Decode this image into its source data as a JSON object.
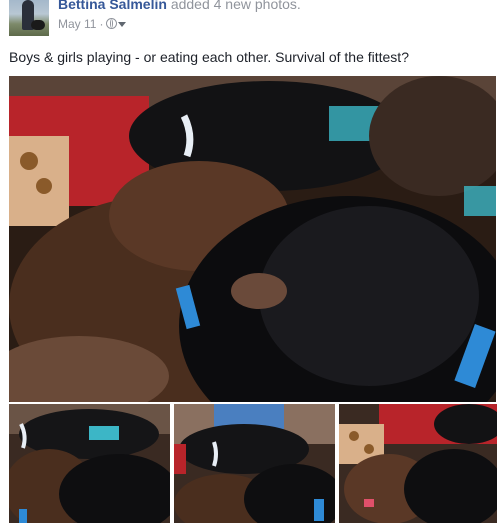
{
  "post": {
    "author": "Bettina Salmelin",
    "action": "added 4 new photos.",
    "date": "May 11",
    "separator": "·",
    "privacy_icon": "globe-icon",
    "caption": "Boys & girls playing - or eating each other. Survival of the fittest?"
  },
  "photos": [
    {
      "name": "main-photo",
      "description_icon": "puppies-photo"
    },
    {
      "name": "thumbnail-1",
      "description_icon": "puppies-photo"
    },
    {
      "name": "thumbnail-2",
      "description_icon": "puppies-photo"
    },
    {
      "name": "thumbnail-3",
      "description_icon": "puppies-photo"
    }
  ],
  "colors": {
    "author_link": "#365899",
    "meta_text": "#90949c",
    "body_text": "#1d2129"
  }
}
